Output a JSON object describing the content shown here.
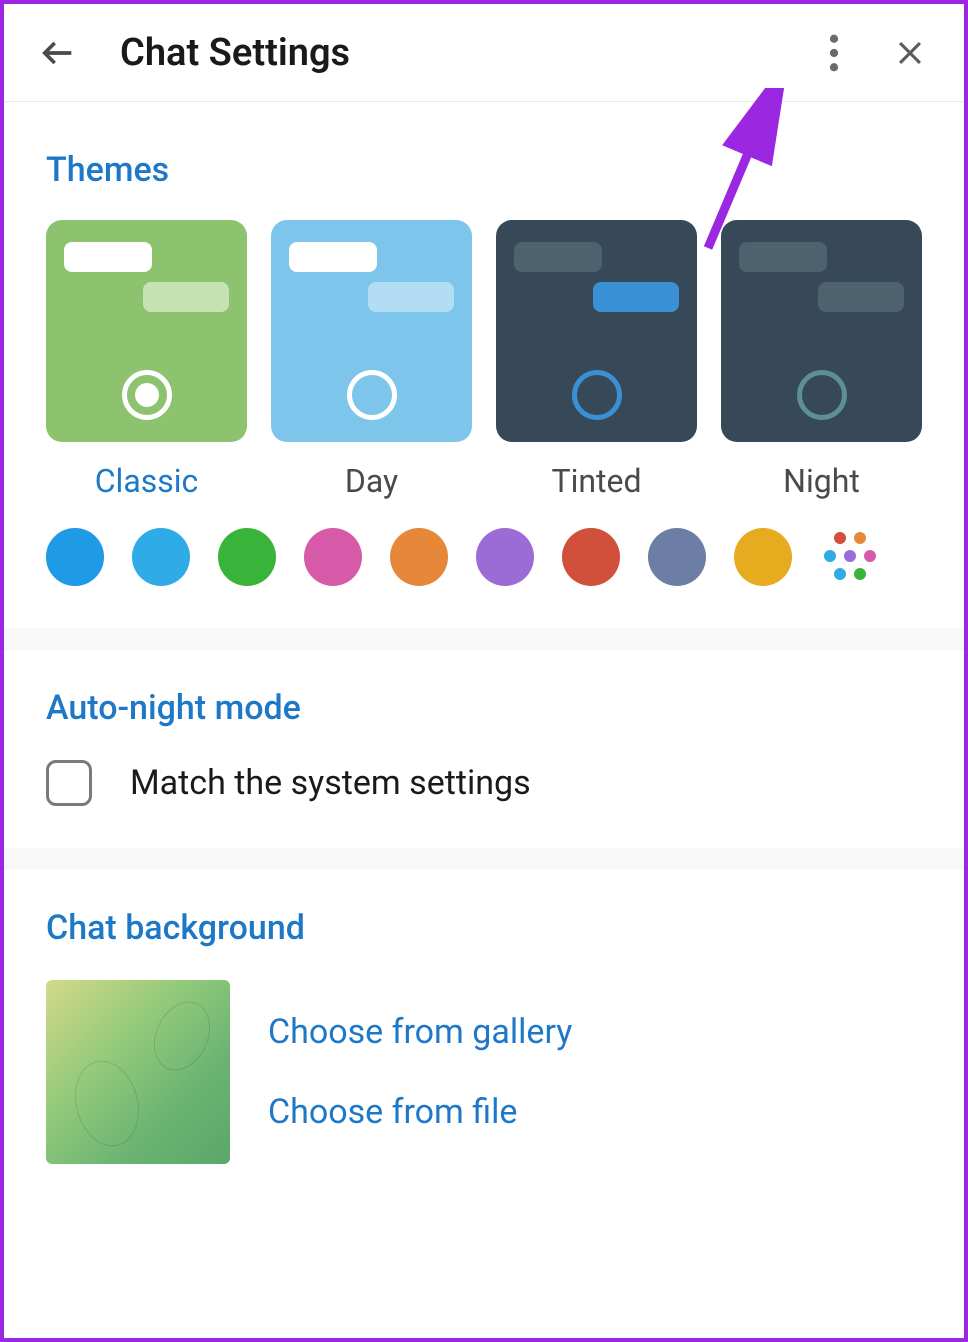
{
  "header": {
    "title": "Chat Settings"
  },
  "themes": {
    "heading": "Themes",
    "options": [
      {
        "label": "Classic",
        "selected": true
      },
      {
        "label": "Day",
        "selected": false
      },
      {
        "label": "Tinted",
        "selected": false
      },
      {
        "label": "Night",
        "selected": false
      }
    ],
    "colors": [
      {
        "hex": "#1e9ae6",
        "selected": true
      },
      {
        "hex": "#2fabe6",
        "selected": false
      },
      {
        "hex": "#3ab33a",
        "selected": false
      },
      {
        "hex": "#d65aa8",
        "selected": false
      },
      {
        "hex": "#e6873a",
        "selected": false
      },
      {
        "hex": "#9b6cd6",
        "selected": false
      },
      {
        "hex": "#d1503c",
        "selected": false
      },
      {
        "hex": "#6c7ea6",
        "selected": false
      },
      {
        "hex": "#e6ab1e",
        "selected": false
      }
    ],
    "multicolor_dots": [
      "#d1503c",
      "#e6873a",
      "#2fabe6",
      "#9b6cd6",
      "#d65aa8",
      "#2fabe6",
      "#3ab33a"
    ]
  },
  "auto_night": {
    "heading": "Auto-night mode",
    "match_label": "Match the system settings",
    "match_checked": false
  },
  "chat_bg": {
    "heading": "Chat background",
    "gallery_label": "Choose from gallery",
    "file_label": "Choose from file"
  }
}
